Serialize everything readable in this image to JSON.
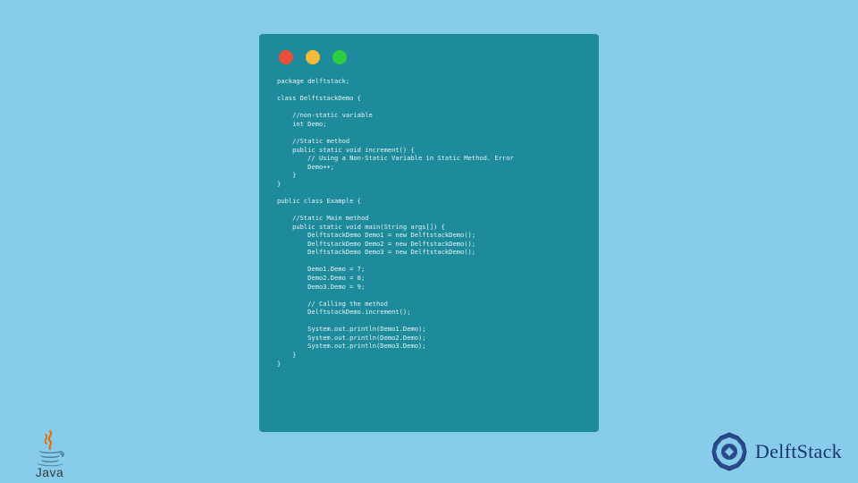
{
  "code_lines": [
    "package delftstack;",
    "",
    "class DelftstackDemo {",
    "",
    "    //non-static variable",
    "    int Demo;",
    "",
    "    //Static method",
    "    public static void increment() {",
    "        // Using a Non-Static Variable in Static Method. Error",
    "        Demo++;",
    "    }",
    "}",
    "",
    "public class Example {",
    "",
    "    //Static Main method",
    "    public static void main(String args[]) {",
    "        DelftstackDemo Demo1 = new DelftstackDemo();",
    "        DelftstackDemo Demo2 = new DelftstackDemo();",
    "        DelftstackDemo Demo3 = new DelftstackDemo();",
    "",
    "        Demo1.Demo = 7;",
    "        Demo2.Demo = 8;",
    "        Demo3.Demo = 9;",
    "",
    "        // Calling the method",
    "        DelftstackDemo.increment();",
    "",
    "        System.out.println(Demo1.Demo);",
    "        System.out.println(Demo2.Demo);",
    "        System.out.println(Demo3.Demo);",
    "    }",
    "}"
  ],
  "java_label": "Java",
  "delftstack_label": "DelftStack",
  "colors": {
    "background": "#87cdeb",
    "window": "#1d8b9c",
    "red": "#e74c3c",
    "yellow": "#f5b93e",
    "green": "#2ecc40",
    "ds_blue": "#19356a"
  }
}
